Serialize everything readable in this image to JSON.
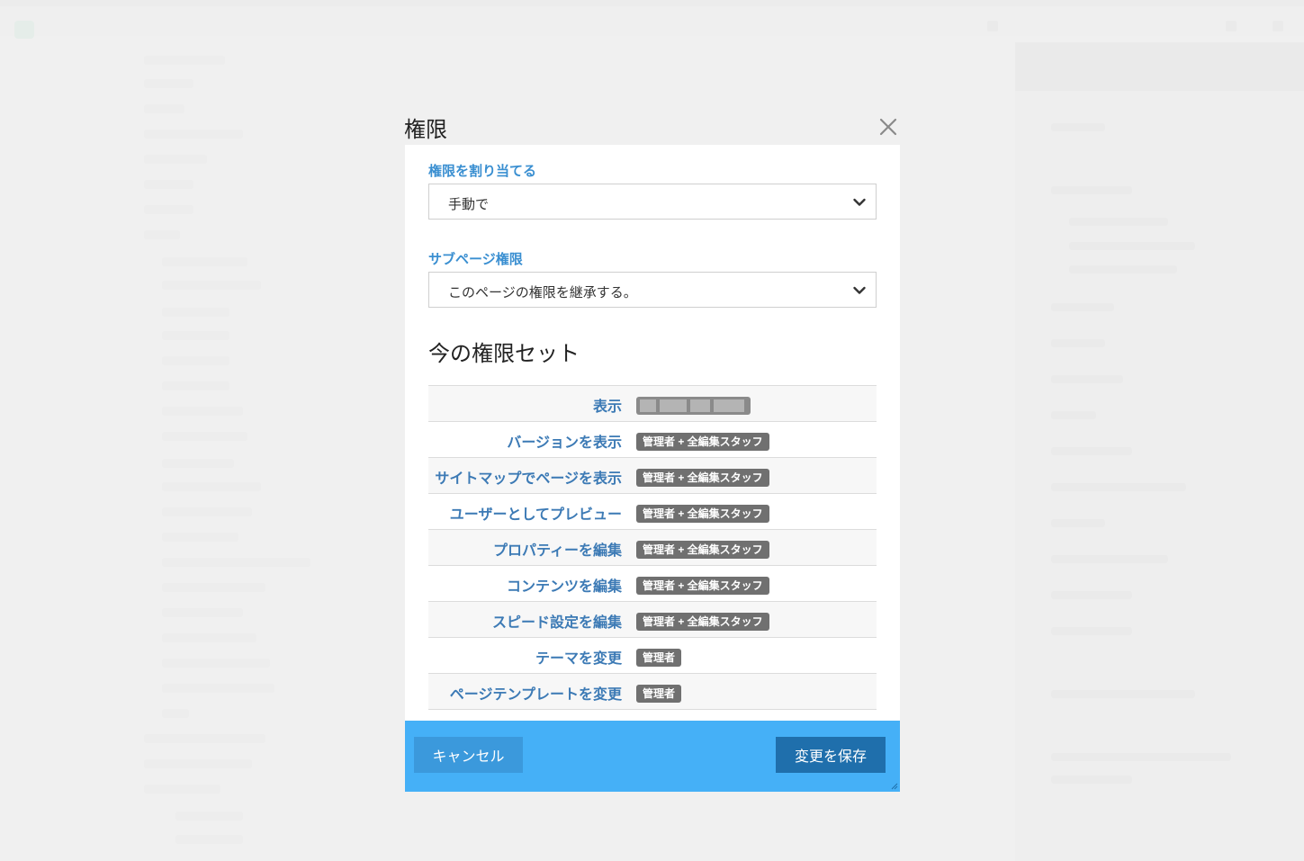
{
  "dialog": {
    "title": "権限",
    "close_icon": "close-icon"
  },
  "assign": {
    "label": "権限を割り当てる",
    "value": "手動で"
  },
  "subpage": {
    "label": "サブページ権限",
    "value": "このページの権限を継承する。"
  },
  "current": {
    "heading": "今の権限セット"
  },
  "permissions": [
    {
      "name": "表示",
      "badge": ""
    },
    {
      "name": "バージョンを表示",
      "badge": "管理者 + 全編集スタッフ"
    },
    {
      "name": "サイトマップでページを表示",
      "badge": "管理者 + 全編集スタッフ"
    },
    {
      "name": "ユーザーとしてプレビュー",
      "badge": "管理者 + 全編集スタッフ"
    },
    {
      "name": "プロパティーを編集",
      "badge": "管理者 + 全編集スタッフ"
    },
    {
      "name": "コンテンツを編集",
      "badge": "管理者 + 全編集スタッフ"
    },
    {
      "name": "スピード設定を編集",
      "badge": "管理者 + 全編集スタッフ"
    },
    {
      "name": "テーマを変更",
      "badge": "管理者"
    },
    {
      "name": "ページテンプレートを変更",
      "badge": "管理者"
    }
  ],
  "footer": {
    "cancel_label": "キャンセル",
    "save_label": "変更を保存"
  },
  "colors": {
    "label_blue": "#3a8fd1",
    "perm_link": "#3c7ab5",
    "footer_bg": "#45b0f7",
    "save_bg": "#1f6fac",
    "cancel_bg": "#3b99dc",
    "badge_bg": "#707070"
  }
}
